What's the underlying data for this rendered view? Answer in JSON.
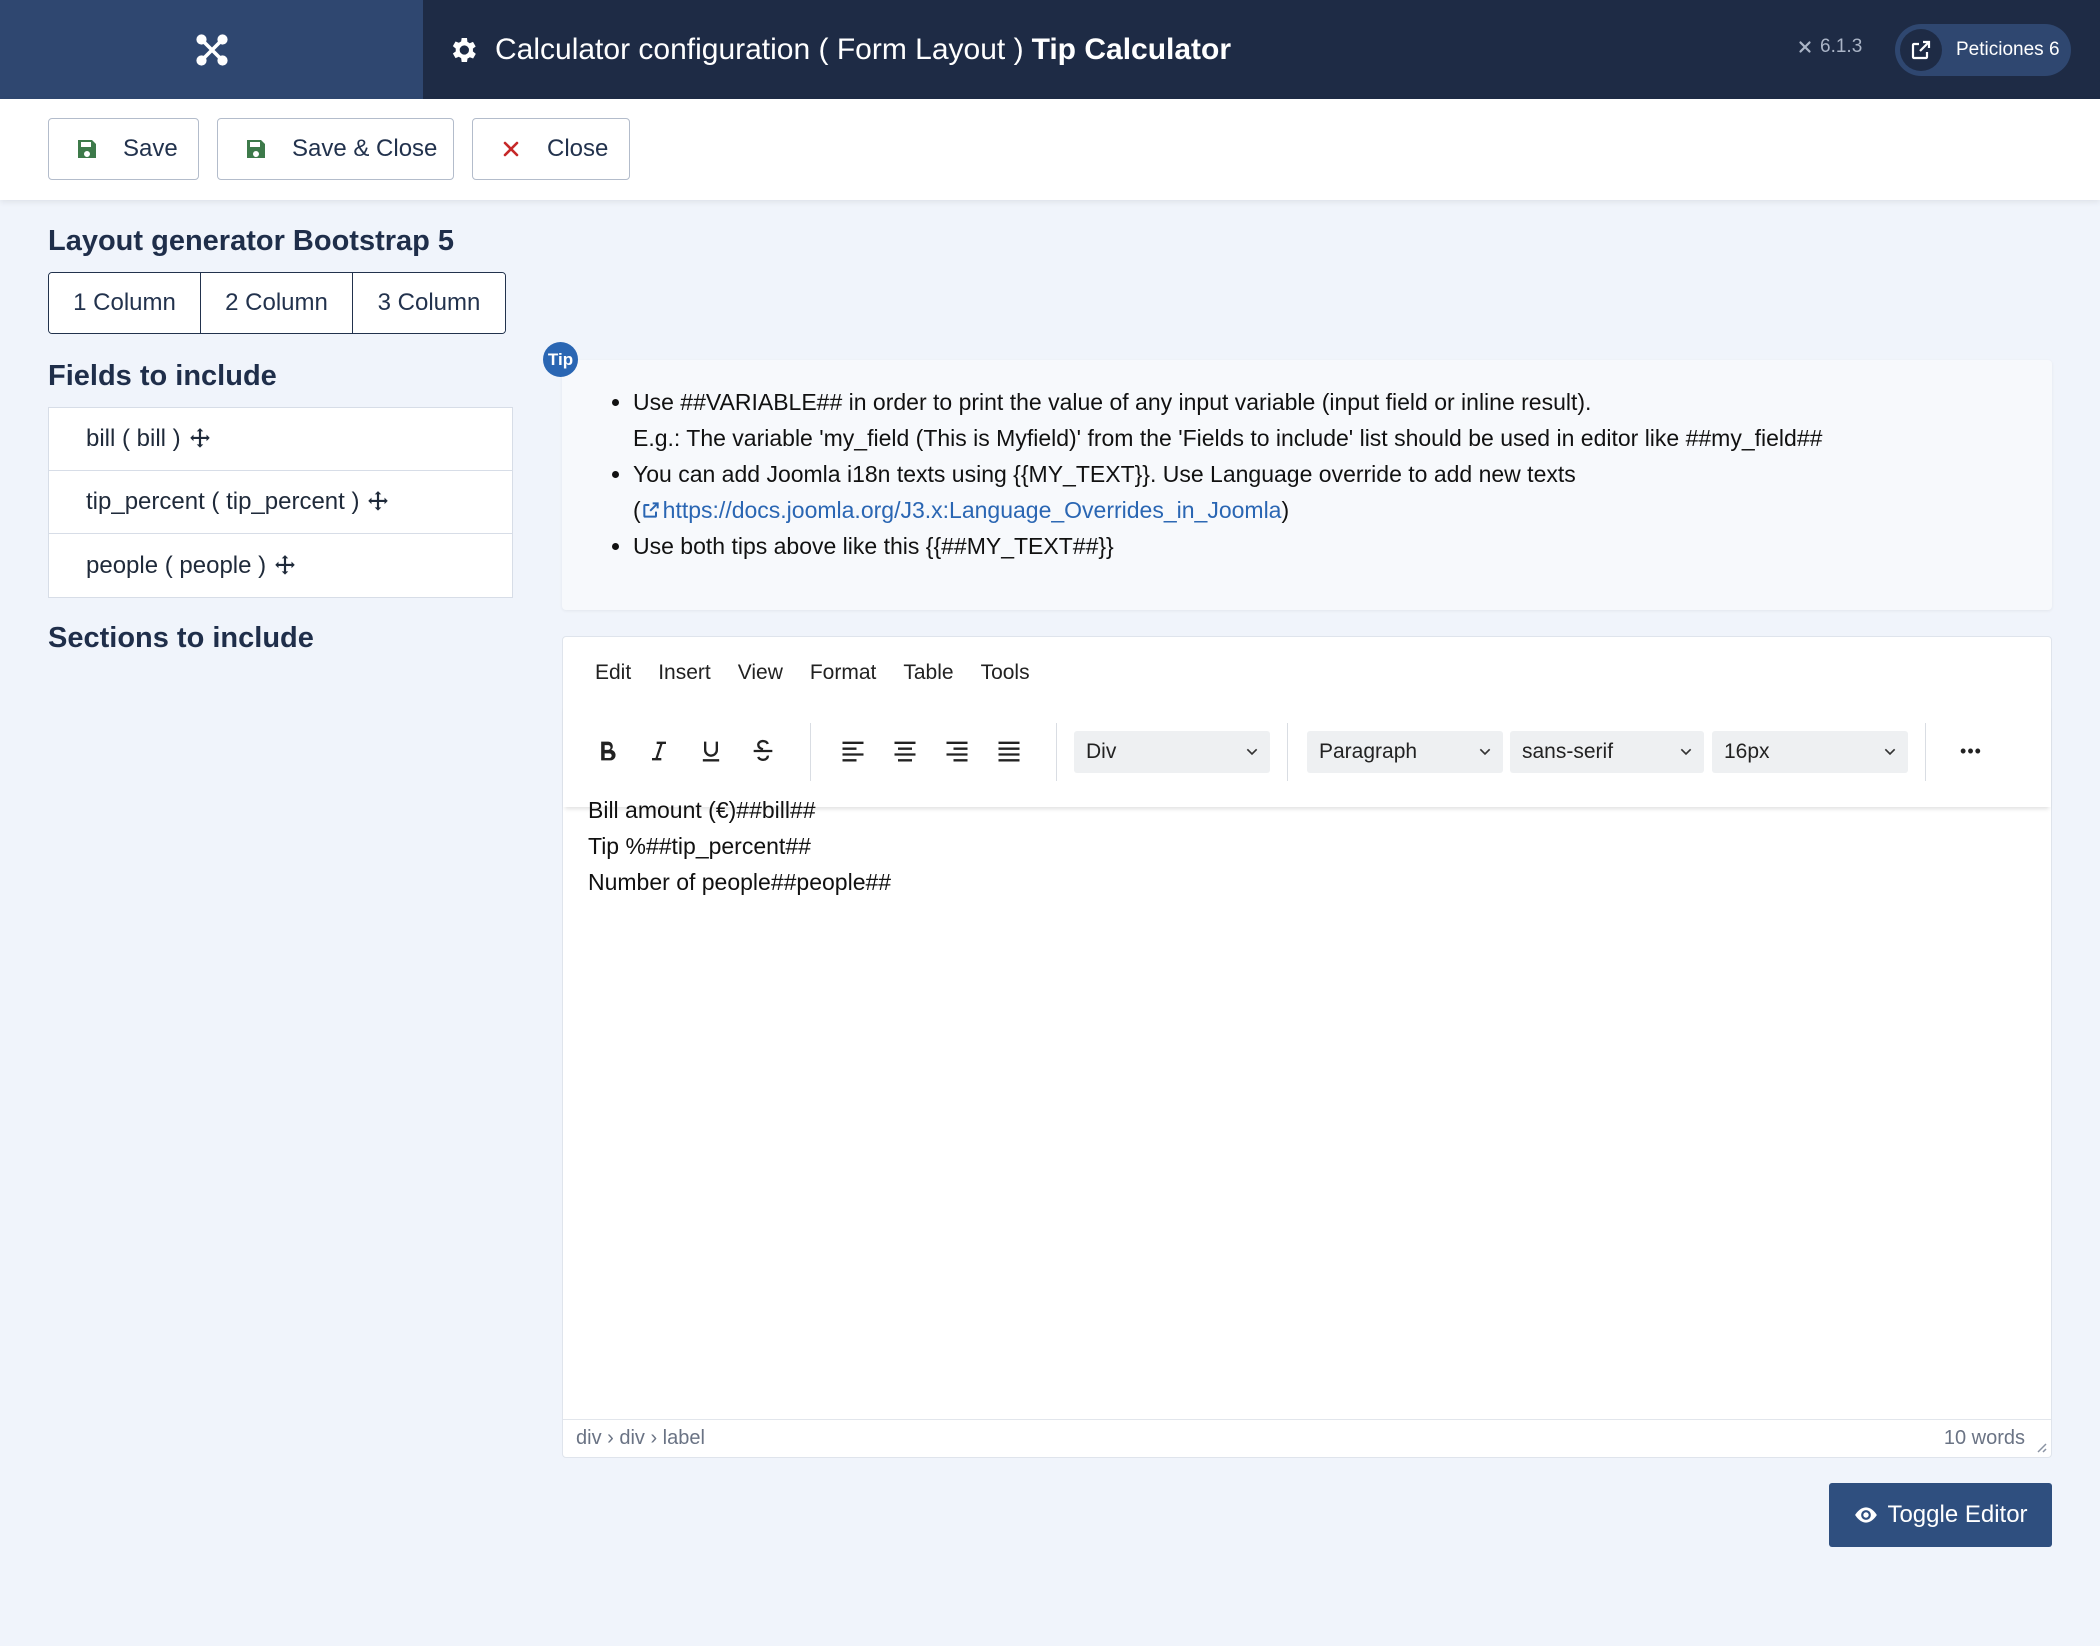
{
  "header": {
    "title": "Calculator configuration ( Form Layout )",
    "title_bold": "Tip Calculator",
    "version": "6.1.3",
    "requests_label": "Peticiones 6"
  },
  "toolbar": {
    "save_label": "Save",
    "save_close_label": "Save & Close",
    "close_label": "Close"
  },
  "layout_generator": {
    "heading": "Layout generator Bootstrap 5",
    "columns": [
      "1 Column",
      "2 Column",
      "3 Column"
    ]
  },
  "fields": {
    "heading": "Fields to include",
    "items": [
      "bill ( bill )",
      "tip_percent ( tip_percent )",
      "people ( people )"
    ]
  },
  "sections": {
    "heading": "Sections to include"
  },
  "tip": {
    "badge": "Tip",
    "line1": "Use ##VARIABLE## in order to print the value of any input variable (input field or inline result).",
    "line1b": "E.g.: The variable 'my_field (This is Myfield)' from the 'Fields to include' list should be used in editor like ##my_field##",
    "line2": "You can add Joomla i18n texts using {{MY_TEXT}}. Use Language override to add new texts",
    "line2_open": "(",
    "link": "https://docs.joomla.org/J3.x:Language_Overrides_in_Joomla",
    "line2_close": ")",
    "line3": "Use both tips above like this {{##MY_TEXT##}}"
  },
  "editor": {
    "menu": [
      "Edit",
      "Insert",
      "View",
      "Format",
      "Table",
      "Tools"
    ],
    "block_select": "Div",
    "format_select": "Paragraph",
    "font_select": "sans-serif",
    "size_select": "16px",
    "more_label": "•••",
    "content": [
      "Bill amount (€)##bill##",
      "Tip %##tip_percent##",
      "Number of people##people##"
    ],
    "status_path": "div › div › label",
    "word_count": "10 words"
  },
  "toggle_editor_label": "Toggle Editor"
}
